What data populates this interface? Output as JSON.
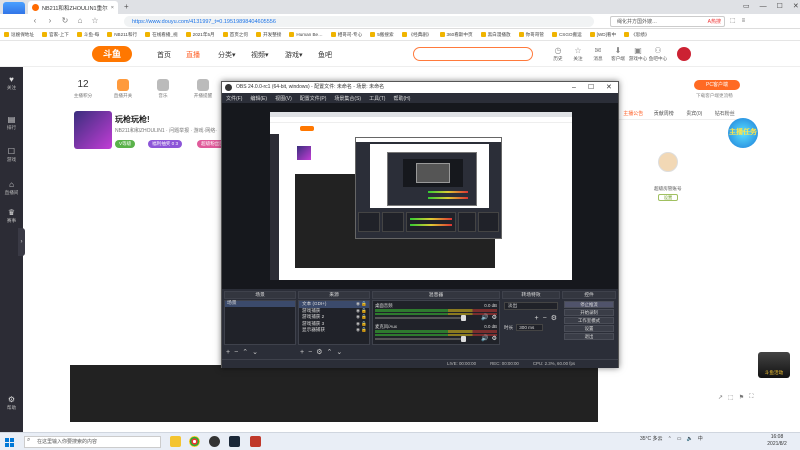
{
  "browser": {
    "logo_label": "云桌面",
    "tab_title": "NB211和和ZHOULIN1重尔",
    "new_tab": "+",
    "url": "https://www.douyu.com/4131997_t=0.19519898404605556",
    "search_placeholder": "绳化井方国外嫂…",
    "search_tag": "A热搜",
    "bookmarks": [
      "逗嫂保地址",
      "官家-上下",
      "斗鱼-每",
      "NB211和行",
      "在线看播_视",
      "2021年5月",
      "首页之何",
      "开发整接",
      "Human Be…",
      "相哥司-专心",
      "5搬搜索",
      "《经典剧》",
      "360看斯中页",
      "黑白漫播放",
      "你哥哥管",
      "CSGO搬运",
      "[WD]看中",
      "《思绩》"
    ]
  },
  "douyu": {
    "logo": "斗鱼",
    "nav": [
      "首页",
      "直播",
      "分类▾",
      "视频▾",
      "游戏▾",
      "鱼吧"
    ],
    "top_icons": [
      {
        "icon": "◷",
        "label": "历史"
      },
      {
        "icon": "☆",
        "label": "关注"
      },
      {
        "icon": "✉",
        "label": "消息"
      },
      {
        "icon": "⬇",
        "label": "客户端"
      },
      {
        "icon": "▣",
        "label": "游戏中心"
      },
      {
        "icon": "⚇",
        "label": "鱼吧中心"
      }
    ],
    "rail": [
      {
        "icon": "♥",
        "label": "关注"
      },
      {
        "icon": "▤",
        "label": "排行"
      },
      {
        "icon": "☐",
        "label": "游戏"
      },
      {
        "icon": "⌂",
        "label": "直播间"
      },
      {
        "icon": "♛",
        "label": "赛事"
      },
      {
        "icon": "⚙",
        "label": "帮助"
      }
    ],
    "stats": [
      {
        "value": "12",
        "label": "主播积分"
      },
      {
        "value": "",
        "label": "直播开关"
      },
      {
        "value": "",
        "label": "音乐"
      },
      {
        "value": "",
        "label": "开播提醒"
      }
    ],
    "room_title": "玩枪玩枪!",
    "room_sub": "NB211和和ZHOULIN1 · 问题举报 · 游戏·网络·",
    "tags": [
      "V等级",
      "福利抽奖 0 3",
      "超级粉丝团"
    ],
    "pc_button": "PC客户端",
    "pc_sub": "下载客户端更流畅",
    "right_tabs": [
      "主播公告",
      "贡献周榜",
      "贵宾(0)",
      "钻石粉丝"
    ],
    "badge": "主播任务",
    "mod_name": "超级房管账号",
    "mod_btn": "设置",
    "footer_art": "斗鱼活动"
  },
  "obs": {
    "title": "OBS 24.0.0-rc1 (64-bit, windows) - 配置文件: 未命名 - 场景: 未命名",
    "menu": [
      "文件(F)",
      "编辑(E)",
      "视图(V)",
      "配置文件(P)",
      "场景集合(S)",
      "工具(T)",
      "帮助(H)"
    ],
    "docks": {
      "scenes": {
        "title": "场景",
        "items": [
          "场景"
        ]
      },
      "sources": {
        "title": "来源",
        "items": [
          "文本 (GDI+)",
          "游戏捕获",
          "游戏捕获 2",
          "游戏捕获 3",
          "显示器捕获"
        ]
      },
      "mixer": {
        "title": "混音器",
        "channels": [
          {
            "name": "桌面音频",
            "value": "0.0 dB"
          },
          {
            "name": "麦克风/Aux",
            "value": "0.0 dB"
          }
        ]
      },
      "transitions": {
        "title": "转场特效",
        "type": "淡出",
        "duration_label": "时长",
        "duration": "300 ms"
      },
      "controls": {
        "title": "控件",
        "buttons": [
          "停止推流",
          "开始录制",
          "工作室模式",
          "设置",
          "退出"
        ]
      }
    },
    "status": {
      "live": "LIVE: 00:00:00",
      "rec": "REC: 00:00:00",
      "cpu": "CPU: 2.3%, 60.00 fps"
    }
  },
  "taskbar": {
    "search_placeholder": "在这里输入你要搜索的内容",
    "weather": "35°C 多云",
    "ime": "中",
    "time": "16:08",
    "date": "2021/8/2"
  }
}
